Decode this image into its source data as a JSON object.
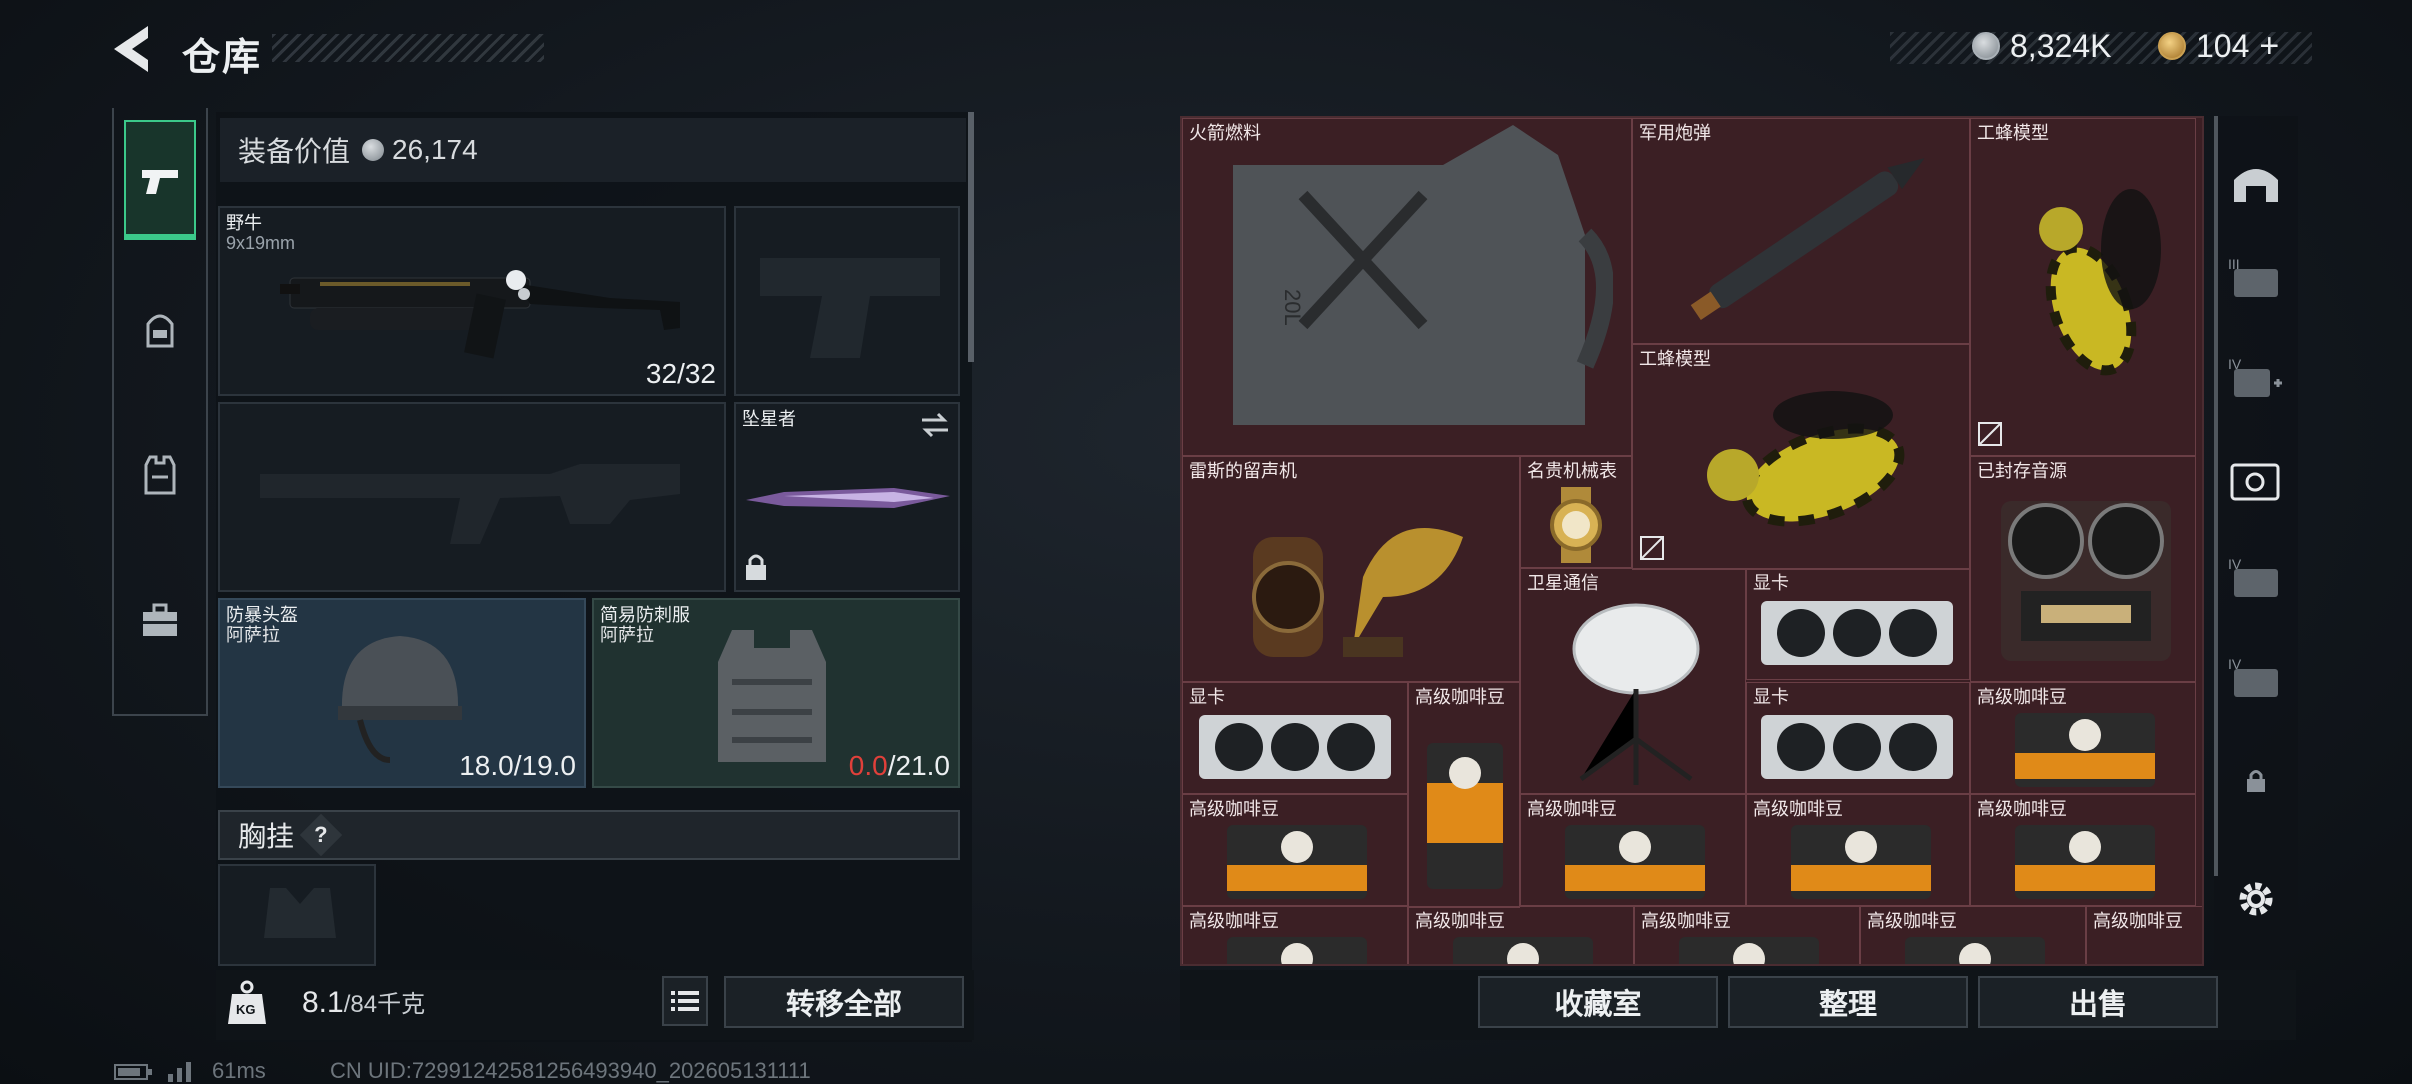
{
  "header": {
    "title": "仓库",
    "currency_silver": "8,324K",
    "currency_gold": "104",
    "add_symbol": "+"
  },
  "equipment": {
    "value_label": "装备价值",
    "value": "26,174",
    "primary_weapon": {
      "name": "野牛",
      "ammo": "9x19mm",
      "count": "32/32"
    },
    "melee": {
      "name": "坠星者"
    },
    "helmet": {
      "name": "防暴头盔",
      "brand": "阿萨拉",
      "durability": "18.0/19.0"
    },
    "armor": {
      "name": "简易防刺服",
      "brand": "阿萨拉",
      "durability_current": "0.0",
      "durability_max": "/21.0"
    },
    "chest_rig": {
      "label": "胸挂",
      "help": "?"
    }
  },
  "weight": {
    "icon_text": "KG",
    "current": "8.1",
    "max": "/84千克"
  },
  "buttons": {
    "transfer_all": "转移全部",
    "collection": "收藏室",
    "organize": "整理",
    "sell": "出售"
  },
  "storage_items": {
    "rocket_fuel": "火箭燃料",
    "shell": "军用炮弹",
    "worker_bee_1": "工蜂模型",
    "worker_bee_2": "工蜂模型",
    "phonograph": "雷斯的留声机",
    "watch": "名贵机械表",
    "satellite": "卫星通信",
    "sealed_source": "已封存音源",
    "gpu_1": "显卡",
    "gpu_2": "显卡",
    "gpu_3": "显卡",
    "coffee_1": "高级咖啡豆",
    "coffee_2": "高级咖啡豆",
    "coffee_3": "高级咖啡豆",
    "coffee_4": "高级咖啡豆",
    "coffee_5": "高级咖啡豆",
    "coffee_6": "高级咖啡豆",
    "coffee_7": "高级咖啡豆",
    "coffee_8": "高级咖啡豆",
    "coffee_9": "高级咖啡豆",
    "coffee_10": "高级咖啡豆",
    "coffee_11": "高级咖啡豆",
    "fuel_can_text": "20L"
  },
  "right_rail": {
    "tier_iii": "III",
    "tier_iv_a": "IV",
    "tier_iv_b": "IV",
    "tier_iv_c": "IV"
  },
  "status_bar": {
    "ping": "61ms",
    "uid": "CN UID:72991242581256493940_202605131111"
  },
  "colors": {
    "accent_green": "#3bc98a",
    "storage_bg": "#3b1f24",
    "durability_zero": "#e0403a"
  }
}
